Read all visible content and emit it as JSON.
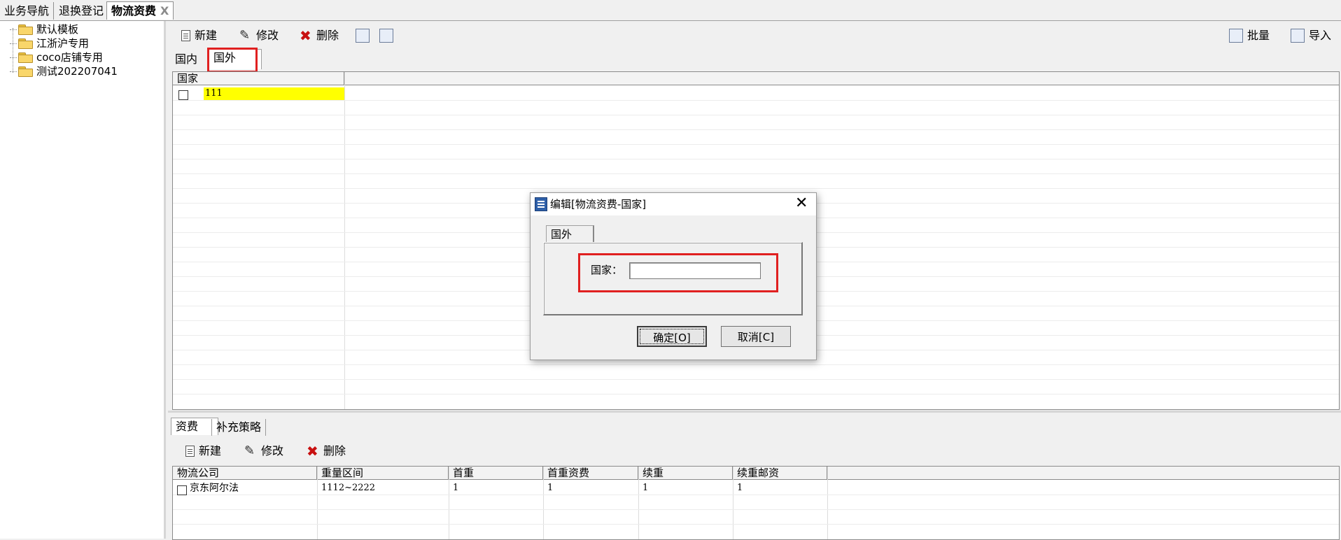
{
  "top_tabs": [
    {
      "label": "业务导航"
    },
    {
      "label": "退换登记"
    },
    {
      "label": "物流资费",
      "close": "X"
    }
  ],
  "tree": {
    "items": [
      {
        "label": "默认模板"
      },
      {
        "label": "江浙沪专用"
      },
      {
        "label": "coco店铺专用"
      },
      {
        "label": "测试202207041"
      }
    ]
  },
  "toolbar": {
    "new_label": "新建",
    "edit_label": "修改",
    "delete_label": "删除",
    "batch_label": "批量",
    "import_label": "导入"
  },
  "region_tabs": {
    "domestic": "国内",
    "foreign": "国外"
  },
  "country_grid": {
    "header": "国家",
    "rows": [
      {
        "country": "111"
      }
    ]
  },
  "bottom_tabs": {
    "fees": "资费",
    "supplement": "补充策略"
  },
  "bottom_toolbar": {
    "new_label": "新建",
    "edit_label": "修改",
    "delete_label": "删除"
  },
  "fee_grid": {
    "headers": [
      "物流公司",
      "重量区间",
      "首重",
      "首重资费",
      "续重",
      "续重邮资"
    ],
    "rows": [
      {
        "company": "京东阿尔法",
        "weight_range": "1112~2222",
        "first_weight": "1",
        "first_fee": "1",
        "extra_weight": "1",
        "extra_fee": "1"
      }
    ]
  },
  "dialog": {
    "title": "编辑[物流资费-国家]",
    "tab": "国外",
    "field_label": "国家：",
    "field_value": "",
    "ok_label": "确定[O]",
    "cancel_label": "取消[C]"
  },
  "colors": {
    "highlight": "#ffff00",
    "annotation": "#e02020"
  }
}
